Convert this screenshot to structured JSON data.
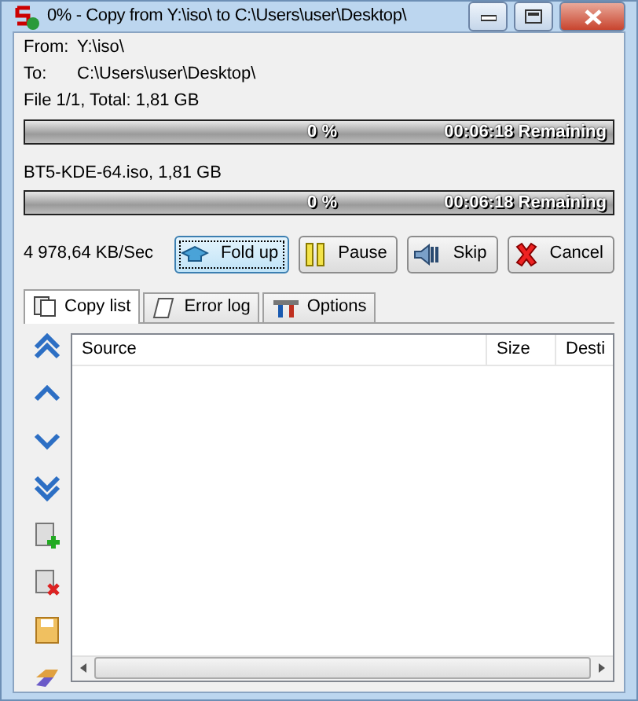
{
  "window": {
    "title": "0% - Copy from Y:\\iso\\ to C:\\Users\\user\\Desktop\\"
  },
  "paths": [
    {
      "label": "From:",
      "value": "Y:\\iso\\"
    },
    {
      "label": "To:",
      "value": "C:\\Users\\user\\Desktop\\"
    }
  ],
  "progress": [
    {
      "caption": "File 1/1, Total: 1,81 GB",
      "level": 0,
      "percent": "0 %",
      "remaining": "00:06:18 Remaining"
    },
    {
      "caption": "BT5-KDE-64.iso, 1,81 GB",
      "level": 0,
      "percent": "0 %",
      "remaining": "00:06:18 Remaining"
    }
  ],
  "speed": "4 978,64 KB/Sec",
  "buttons": [
    {
      "label": "Fold up",
      "kind": "fold",
      "focused": true
    },
    {
      "label": "Pause",
      "kind": "pause",
      "focused": false
    },
    {
      "label": "Skip",
      "kind": "skip",
      "focused": false
    },
    {
      "label": "Cancel",
      "kind": "cancel",
      "focused": false
    }
  ],
  "tabs": [
    {
      "label": "Copy list",
      "kind": "list",
      "selected": true
    },
    {
      "label": "Error log",
      "kind": "log",
      "selected": false
    },
    {
      "label": "Options",
      "kind": "options",
      "selected": false
    }
  ],
  "table": {
    "columns": [
      "Source",
      "Size",
      "Desti"
    ]
  }
}
